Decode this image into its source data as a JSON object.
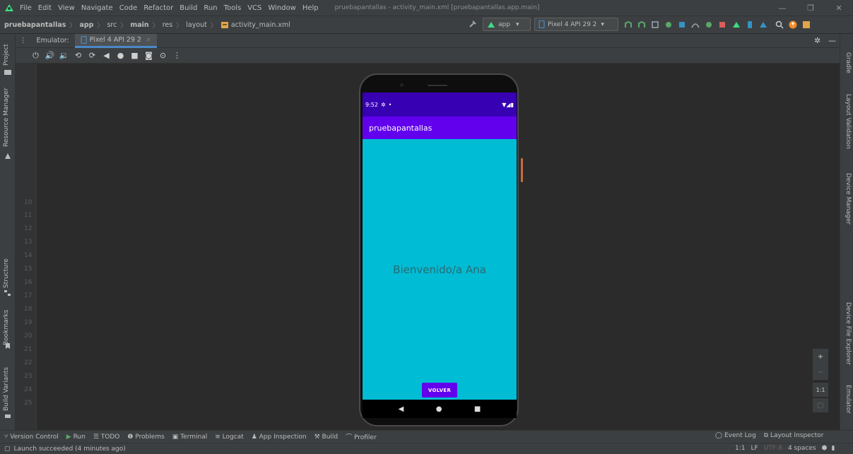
{
  "menubar": {
    "items": [
      "File",
      "Edit",
      "View",
      "Navigate",
      "Code",
      "Refactor",
      "Build",
      "Run",
      "Tools",
      "VCS",
      "Window",
      "Help"
    ],
    "title": "pruebapantallas - activity_main.xml [pruebapantallas.app.main]"
  },
  "breadcrumb": {
    "project": "pruebapantallas",
    "items": [
      "app",
      "src",
      "main",
      "res",
      "layout"
    ],
    "file": "activity_main.xml"
  },
  "toolbar": {
    "run_config": "app",
    "device": "Pixel 4 API 29 2"
  },
  "left_tools": [
    "Project",
    "Resource Manager",
    "Structure",
    "Bookmarks",
    "Build Variants"
  ],
  "right_tools": [
    "Gradle",
    "Layout Validation",
    "Device Manager",
    "Device File Explorer",
    "Emulator"
  ],
  "emulator": {
    "label": "Emulator:",
    "tab": "Pixel 4 API 29 2"
  },
  "gutter_lines": [
    "10",
    "11",
    "12",
    "13",
    "14",
    "15",
    "16",
    "17",
    "18",
    "19",
    "20",
    "21",
    "22",
    "23",
    "24",
    "25"
  ],
  "phone": {
    "time": "9:52",
    "app_title": "pruebapantallas",
    "welcome_text": "Bienvenido/a Ana",
    "button_label": "VOLVER"
  },
  "zoom": {
    "plus": "+",
    "minus": "−",
    "ratio": "1:1"
  },
  "bottom_tools": [
    "Version Control",
    "Run",
    "TODO",
    "Problems",
    "Terminal",
    "Logcat",
    "App Inspection",
    "Build",
    "Profiler"
  ],
  "bottom_right": [
    "Event Log",
    "Layout Inspector"
  ],
  "status": {
    "message": "Launch succeeded (4 minutes ago)",
    "position": "1:1",
    "line_sep": "LF",
    "encoding": "UTF-8",
    "indent": "4 spaces"
  },
  "colors": {
    "ide_bg": "#2b2b2b",
    "panel": "#3c3f41",
    "status_bar": "#3700b3",
    "app_bar": "#6200ee",
    "content": "#00bcd4",
    "accent": "#4a88c7"
  }
}
